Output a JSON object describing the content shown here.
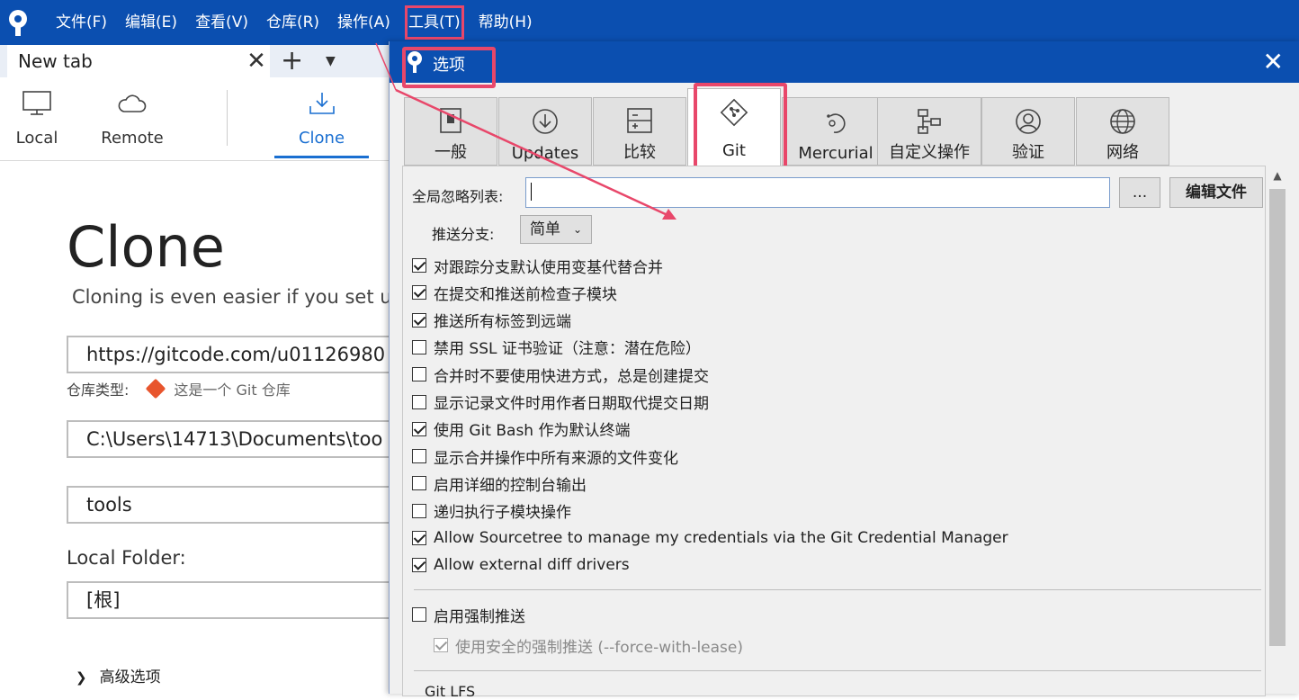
{
  "menubar": {
    "items": [
      "文件(F)",
      "编辑(E)",
      "查看(V)",
      "仓库(R)",
      "操作(A)",
      "工具(T)",
      "帮助(H)"
    ]
  },
  "tabbar": {
    "tab_label": "New tab",
    "close_glyph": "✕",
    "add_glyph": "+",
    "dropdown_glyph": "▼"
  },
  "toolbar": {
    "local": "Local",
    "remote": "Remote",
    "clone": "Clone"
  },
  "clone_page": {
    "title": "Clone",
    "subtitle": "Cloning is even easier if you set u",
    "url_value": "https://gitcode.com/u01126980",
    "repo_type_label": "仓库类型:",
    "repo_type_value": "这是一个 Git 仓库",
    "path_value": "C:\\Users\\14713\\Documents\\too",
    "name_value": "tools",
    "local_folder_label": "Local Folder:",
    "local_folder_value": "[根]",
    "advanced_label": "高级选项",
    "advanced_chevron": "❯"
  },
  "dialog": {
    "title": "选项",
    "close_glyph": "✕",
    "tabs": [
      {
        "label": "一般",
        "icon": "toggle-icon"
      },
      {
        "label": "Updates",
        "icon": "download-circle-icon"
      },
      {
        "label": "比较",
        "icon": "diff-icon"
      },
      {
        "label": "Git",
        "icon": "git-icon"
      },
      {
        "label": "Mercurial",
        "icon": "mercurial-icon"
      },
      {
        "label": "自定义操作",
        "icon": "custom-actions-icon"
      },
      {
        "label": "验证",
        "icon": "user-circle-icon"
      },
      {
        "label": "网络",
        "icon": "globe-icon"
      }
    ],
    "active_tab": "Git",
    "global_ignore_label": "全局忽略列表:",
    "global_ignore_value": "",
    "browse_button": "...",
    "edit_file_button": "编辑文件",
    "push_branch_label": "推送分支:",
    "push_branch_value": "简单",
    "checkboxes": [
      {
        "label": "对跟踪分支默认使用变基代替合并",
        "checked": true
      },
      {
        "label": "在提交和推送前检查子模块",
        "checked": true
      },
      {
        "label": "推送所有标签到远端",
        "checked": true
      },
      {
        "label": "禁用 SSL 证书验证（注意：潜在危险）",
        "checked": false
      },
      {
        "label": "合并时不要使用快进方式，总是创建提交",
        "checked": false
      },
      {
        "label": "显示记录文件时用作者日期取代提交日期",
        "checked": false
      },
      {
        "label": "使用 Git Bash 作为默认终端",
        "checked": true
      },
      {
        "label": "显示合并操作中所有来源的文件变化",
        "checked": false
      },
      {
        "label": "启用详细的控制台输出",
        "checked": false
      },
      {
        "label": "递归执行子模块操作",
        "checked": false
      },
      {
        "label": "Allow Sourcetree to manage my credentials via the Git Credential Manager",
        "checked": true
      },
      {
        "label": "Allow external diff drivers",
        "checked": true
      }
    ],
    "force_push": {
      "label": "启用强制推送",
      "checked": false
    },
    "force_with_lease": {
      "label": "使用安全的强制推送 (--force-with-lease)",
      "checked": true,
      "disabled": true
    },
    "git_lfs_label": "Git LFS"
  },
  "colors": {
    "titlebar": "#0b4fb0",
    "highlight": "#e8476a",
    "accent": "#1a6fd1"
  }
}
